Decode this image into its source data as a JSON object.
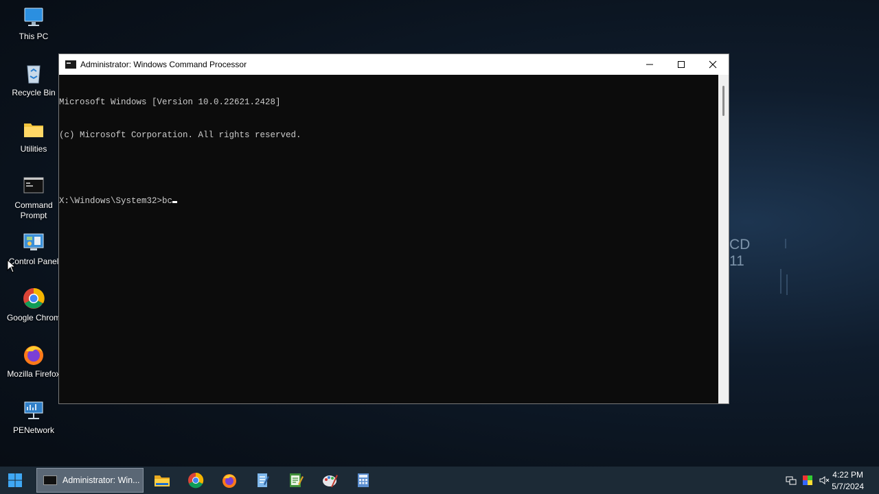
{
  "desktop": {
    "icons": [
      {
        "label": "This PC",
        "icon": "monitor-icon"
      },
      {
        "label": "Recycle Bin",
        "icon": "recycle-bin-icon"
      },
      {
        "label": "Utilities",
        "icon": "folder-icon"
      },
      {
        "label_line1": "Command",
        "label_line2": "Prompt",
        "icon": "command-prompt-icon"
      },
      {
        "label": "Control Panel",
        "icon": "control-panel-icon"
      },
      {
        "label": "Google Chrom",
        "icon": "chrome-icon"
      },
      {
        "label": "Mozilla Firefox",
        "icon": "firefox-icon"
      },
      {
        "label": "PENetwork",
        "icon": "network-icon"
      }
    ],
    "wallpaper_text_line1": "CD",
    "wallpaper_text_line2": "11"
  },
  "window": {
    "title": "Administrator: Windows Command Processor",
    "console_lines": [
      "Microsoft Windows [Version 10.0.22621.2428]",
      "(c) Microsoft Corporation. All rights reserved.",
      "",
      "X:\\Windows\\System32>bc"
    ],
    "minimize_icon": "minimize-icon",
    "maximize_icon": "maximize-icon",
    "close_icon": "close-icon"
  },
  "taskbar": {
    "active_task_label": "Administrator: Win...",
    "pinned": [
      "file-explorer-icon",
      "chrome-icon",
      "firefox-icon",
      "notepad-icon",
      "editor-icon",
      "paint-icon",
      "calculator-icon"
    ],
    "tray": [
      "network-settings-icon",
      "color-icon",
      "volume-muted-icon"
    ],
    "time": "4:22 PM",
    "date": "5/7/2024"
  },
  "colors": {
    "console_bg": "#0c0c0c",
    "console_text": "#cccccc",
    "taskbar_bg": "#1c2a36"
  }
}
